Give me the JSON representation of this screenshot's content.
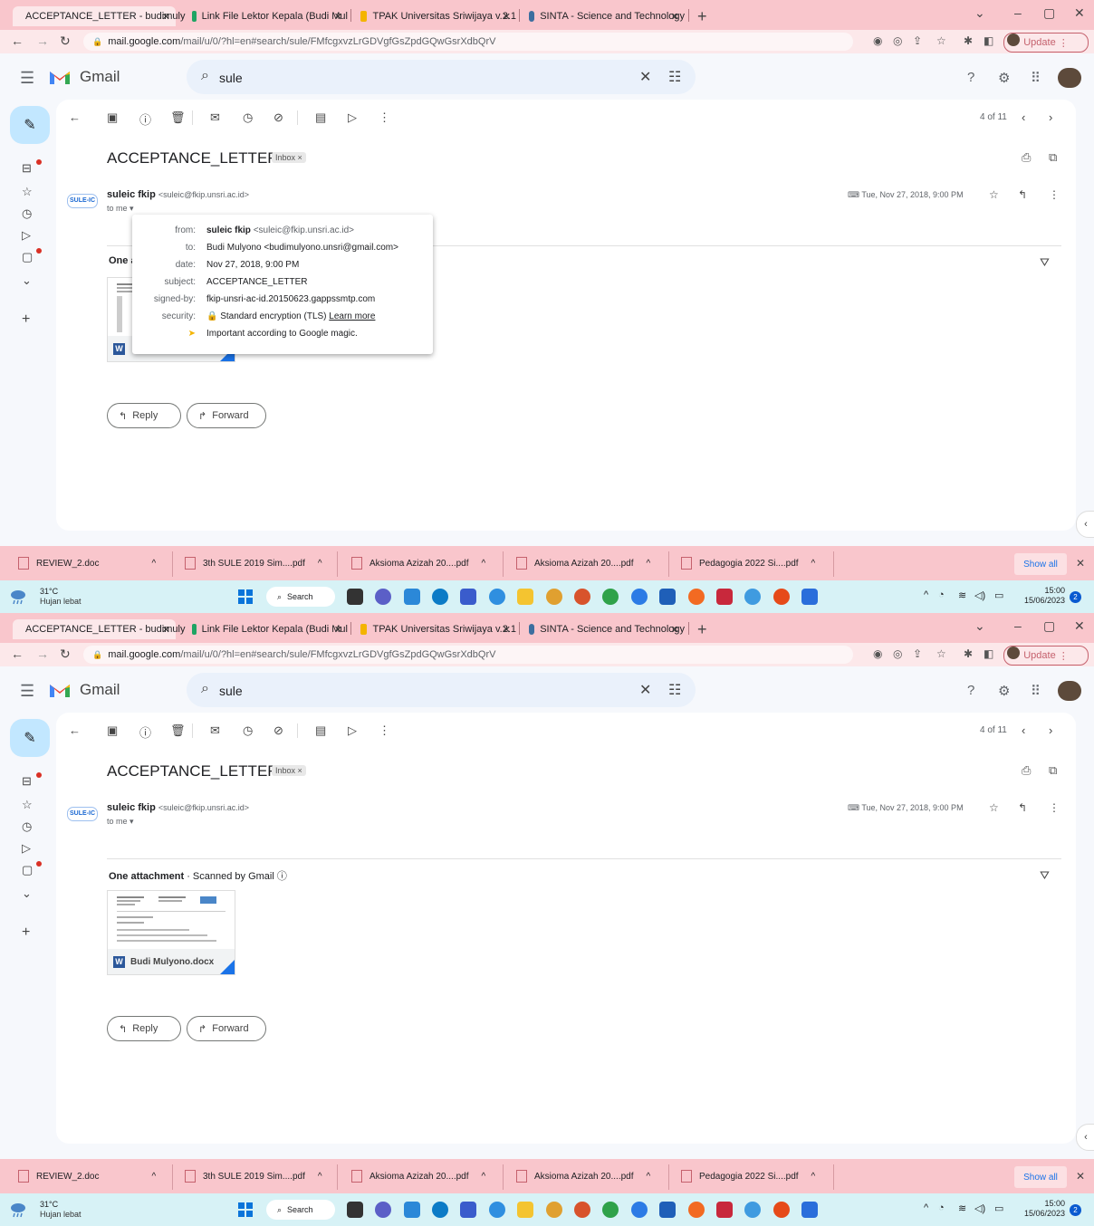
{
  "browser": {
    "tabs": [
      {
        "title": "ACCEPTANCE_LETTER - budimuly",
        "icon": "gmail-icon",
        "color": "#d93025"
      },
      {
        "title": "Link File Lektor Kepala (Budi Mul",
        "icon": "google-drive-icon",
        "color": "#1fa463"
      },
      {
        "title": "TPAK Universitas Sriwijaya v.2.1",
        "icon": "tpak-icon",
        "color": "#f4b400"
      },
      {
        "title": "SINTA - Science and Technology",
        "icon": "sinta-icon",
        "color": "#3c6e9f"
      }
    ],
    "new_tab": "+",
    "url_host": "mail.google.com",
    "url_path": "/mail/u/0/?hl=en#search/sule/FMfcgxvzLrGDVgfGsZpdGQwGsrXdbQrV",
    "update_label": "Update"
  },
  "gmail": {
    "logo_text": "Gmail",
    "search_value": "sule",
    "count_text": "4 of 11",
    "subject": "ACCEPTANCE_LETTER",
    "label_chip": "Inbox ×",
    "sender_logo": "SULE-IC",
    "sender_name": "suleic fkip",
    "sender_email": "<suleic@fkip.unsri.ac.id>",
    "to_me": "to me",
    "date": "Tue, Nov 27, 2018, 9:00 PM",
    "attach_count": "One attachment",
    "attach_scanned": "Scanned by Gmail",
    "attach_file": "Budi Mulyono.docx",
    "reply_label": "Reply",
    "forward_label": "Forward"
  },
  "details_popup": {
    "rows": [
      {
        "key": "from:",
        "name": "suleic fkip",
        "value": "<suleic@fkip.unsri.ac.id>"
      },
      {
        "key": "to:",
        "value": "Budi Mulyono <budimulyono.unsri@gmail.com>"
      },
      {
        "key": "date:",
        "value": "Nov 27, 2018, 9:00 PM"
      },
      {
        "key": "subject:",
        "value": "ACCEPTANCE_LETTER"
      },
      {
        "key": "signed-by:",
        "value": "fkip-unsri-ac-id.20150623.gappssmtp.com"
      },
      {
        "key": "security:",
        "value": "Standard encryption (TLS)",
        "link": "Learn more"
      },
      {
        "key": "",
        "value": "Important according to Google magic."
      }
    ]
  },
  "downloads": {
    "items": [
      "REVIEW_2.doc",
      "3th SULE 2019 Sim....pdf",
      "Aksioma Azizah 20....pdf",
      "Aksioma Azizah 20....pdf",
      "Pedagogia 2022 Si....pdf"
    ],
    "show_all": "Show all"
  },
  "taskbar": {
    "temp": "31°C",
    "weather": "Hujan lebat",
    "search": "Search",
    "time": "15:00",
    "date": "15/06/2023",
    "notifications": "2"
  },
  "colors": {
    "browser_frame": "#f9c6cc",
    "compose": "#c2e7ff",
    "search_bg": "#eaf1fb",
    "taskbar": "#d7f2f6"
  }
}
